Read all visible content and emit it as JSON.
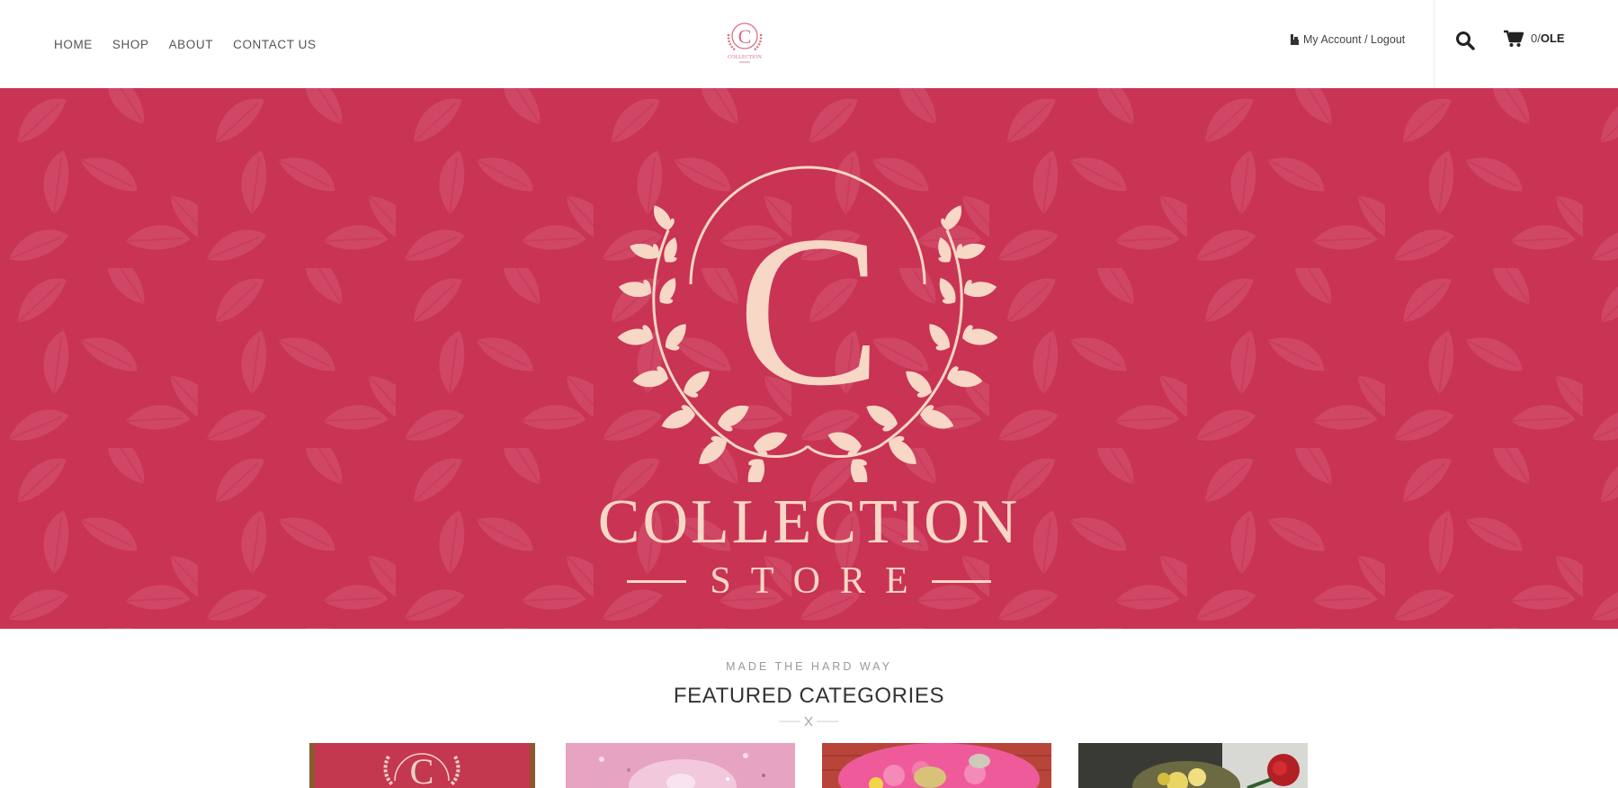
{
  "header": {
    "nav": [
      {
        "label": "HOME"
      },
      {
        "label": "SHOP"
      },
      {
        "label": "ABOUT"
      },
      {
        "label": "CONTACT US"
      }
    ],
    "logo_text": "COLLECTION",
    "account_label": "My Account / Logout",
    "cart": {
      "count": "0",
      "separator": "/",
      "currency": "OLE"
    }
  },
  "hero": {
    "monogram": "C",
    "title": "COLLECTION",
    "subtitle": "STORE"
  },
  "featured": {
    "kicker": "MADE THE HARD WAY",
    "title": "FEATURED CATEGORIES"
  },
  "colors": {
    "brand_crimson": "#c93354",
    "cream": "#f7d7c6",
    "nav_text": "#555555"
  },
  "icons": [
    "user-icon",
    "search-icon",
    "cart-icon",
    "close-icon"
  ]
}
